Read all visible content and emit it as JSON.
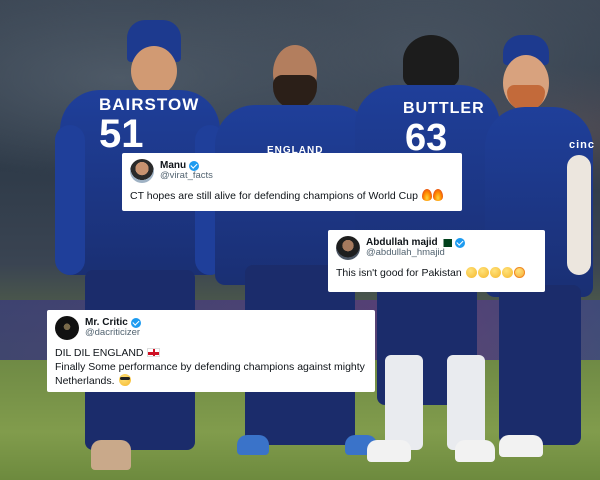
{
  "photo": {
    "players": [
      {
        "name": "BAIRSTOW",
        "number": "51"
      },
      {
        "name": "BUTTLER",
        "number": "63"
      }
    ],
    "chest_text": "ENGLAND",
    "sponsor": "cinc"
  },
  "tweets": [
    {
      "name": "Manu",
      "handle": "@virat_facts",
      "text": "CT hopes are still alive for defending champions of World Cup",
      "emojis": [
        "fire",
        "fire"
      ]
    },
    {
      "name": "Abdullah majid",
      "handle": "@abdullah_hmajid",
      "text": "This isn't good for Pakistan",
      "emojis": [
        "face",
        "face",
        "face",
        "face",
        "face"
      ]
    },
    {
      "name": "Mr. Critic",
      "handle": "@dacriticizer",
      "line1": "DIL DIL ENGLAND",
      "line2": "Finally Some performance by defending champions against mighty Netherlands.",
      "emojis": [
        "sunglasses-face"
      ]
    }
  ],
  "colors": {
    "verified": "#1d9bf0",
    "jersey": "#1f3f9a"
  }
}
